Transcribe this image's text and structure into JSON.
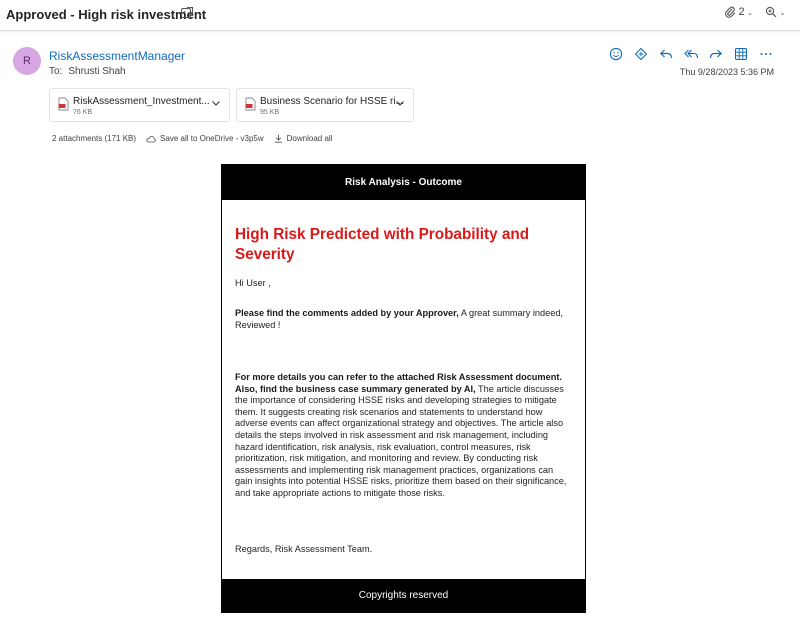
{
  "header": {
    "subject": "Approved - High risk investment",
    "attachment_count": "2",
    "icons": [
      "tag-icon",
      "paperclip-icon",
      "zoom-icon"
    ]
  },
  "message": {
    "avatar_initial": "R",
    "sender": "RiskAssessmentManager",
    "to_label": "To:",
    "to_name": "Shrusti Shah",
    "timestamp": "Thu 9/28/2023 5:36 PM",
    "action_icons": [
      "emoji-icon",
      "immersive-reader-icon",
      "reply-icon",
      "reply-all-icon",
      "forward-icon",
      "apps-icon",
      "more-icon"
    ]
  },
  "attachments": {
    "items": [
      {
        "name": "RiskAssessment_Investment...",
        "size": "76 KB"
      },
      {
        "name": "Business Scenario for HSSE ri...",
        "size": "95 KB"
      }
    ],
    "summary": "2 attachments (171 KB)",
    "save_onedrive": "Save all to OneDrive - v3p5w",
    "download_all": "Download all"
  },
  "email": {
    "banner": "Risk Analysis - Outcome",
    "title": "High Risk Predicted with Probability and Severity",
    "greeting": "Hi User ,",
    "comment_lead": "Please find the comments added by your Approver,",
    "comment_text": " A great summary indeed, Reviewed !",
    "details_lead": "For more details you can refer to the attached Risk Assessment document. Also, find the business case summary generated by AI,",
    "details_text": " The article discusses the importance of considering HSSE risks and developing strategies to mitigate them. It suggests creating risk scenarios and statements to understand how adverse events can affect organizational strategy and objectives. The article also details the steps involved in risk assessment and risk management, including hazard identification, risk analysis, risk evaluation, control measures, risk prioritization, risk mitigation, and monitoring and review. By conducting risk assessments and implementing risk management practices, organizations can gain insights into potential HSSE risks, prioritize them based on their significance, and take appropriate actions to mitigate those risks.",
    "signoff": "Regards, Risk Assessment Team.",
    "footer": "Copyrights reserved"
  },
  "colors": {
    "link": "#0f6cbd",
    "title_red": "#d91a1a",
    "avatar_bg": "#d8a6e3",
    "banner_bg": "#000000"
  }
}
